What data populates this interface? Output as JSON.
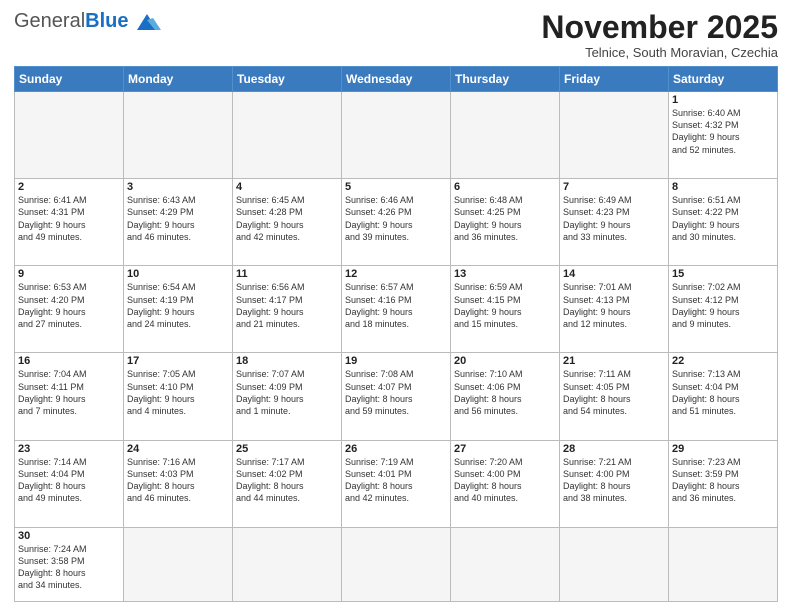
{
  "header": {
    "logo": {
      "general": "General",
      "blue": "Blue"
    },
    "title": "November 2025",
    "subtitle": "Telnice, South Moravian, Czechia"
  },
  "weekdays": [
    "Sunday",
    "Monday",
    "Tuesday",
    "Wednesday",
    "Thursday",
    "Friday",
    "Saturday"
  ],
  "weeks": [
    [
      {
        "day": "",
        "info": ""
      },
      {
        "day": "",
        "info": ""
      },
      {
        "day": "",
        "info": ""
      },
      {
        "day": "",
        "info": ""
      },
      {
        "day": "",
        "info": ""
      },
      {
        "day": "",
        "info": ""
      },
      {
        "day": "1",
        "info": "Sunrise: 6:40 AM\nSunset: 4:32 PM\nDaylight: 9 hours\nand 52 minutes."
      }
    ],
    [
      {
        "day": "2",
        "info": "Sunrise: 6:41 AM\nSunset: 4:31 PM\nDaylight: 9 hours\nand 49 minutes."
      },
      {
        "day": "3",
        "info": "Sunrise: 6:43 AM\nSunset: 4:29 PM\nDaylight: 9 hours\nand 46 minutes."
      },
      {
        "day": "4",
        "info": "Sunrise: 6:45 AM\nSunset: 4:28 PM\nDaylight: 9 hours\nand 42 minutes."
      },
      {
        "day": "5",
        "info": "Sunrise: 6:46 AM\nSunset: 4:26 PM\nDaylight: 9 hours\nand 39 minutes."
      },
      {
        "day": "6",
        "info": "Sunrise: 6:48 AM\nSunset: 4:25 PM\nDaylight: 9 hours\nand 36 minutes."
      },
      {
        "day": "7",
        "info": "Sunrise: 6:49 AM\nSunset: 4:23 PM\nDaylight: 9 hours\nand 33 minutes."
      },
      {
        "day": "8",
        "info": "Sunrise: 6:51 AM\nSunset: 4:22 PM\nDaylight: 9 hours\nand 30 minutes."
      }
    ],
    [
      {
        "day": "9",
        "info": "Sunrise: 6:53 AM\nSunset: 4:20 PM\nDaylight: 9 hours\nand 27 minutes."
      },
      {
        "day": "10",
        "info": "Sunrise: 6:54 AM\nSunset: 4:19 PM\nDaylight: 9 hours\nand 24 minutes."
      },
      {
        "day": "11",
        "info": "Sunrise: 6:56 AM\nSunset: 4:17 PM\nDaylight: 9 hours\nand 21 minutes."
      },
      {
        "day": "12",
        "info": "Sunrise: 6:57 AM\nSunset: 4:16 PM\nDaylight: 9 hours\nand 18 minutes."
      },
      {
        "day": "13",
        "info": "Sunrise: 6:59 AM\nSunset: 4:15 PM\nDaylight: 9 hours\nand 15 minutes."
      },
      {
        "day": "14",
        "info": "Sunrise: 7:01 AM\nSunset: 4:13 PM\nDaylight: 9 hours\nand 12 minutes."
      },
      {
        "day": "15",
        "info": "Sunrise: 7:02 AM\nSunset: 4:12 PM\nDaylight: 9 hours\nand 9 minutes."
      }
    ],
    [
      {
        "day": "16",
        "info": "Sunrise: 7:04 AM\nSunset: 4:11 PM\nDaylight: 9 hours\nand 7 minutes."
      },
      {
        "day": "17",
        "info": "Sunrise: 7:05 AM\nSunset: 4:10 PM\nDaylight: 9 hours\nand 4 minutes."
      },
      {
        "day": "18",
        "info": "Sunrise: 7:07 AM\nSunset: 4:09 PM\nDaylight: 9 hours\nand 1 minute."
      },
      {
        "day": "19",
        "info": "Sunrise: 7:08 AM\nSunset: 4:07 PM\nDaylight: 8 hours\nand 59 minutes."
      },
      {
        "day": "20",
        "info": "Sunrise: 7:10 AM\nSunset: 4:06 PM\nDaylight: 8 hours\nand 56 minutes."
      },
      {
        "day": "21",
        "info": "Sunrise: 7:11 AM\nSunset: 4:05 PM\nDaylight: 8 hours\nand 54 minutes."
      },
      {
        "day": "22",
        "info": "Sunrise: 7:13 AM\nSunset: 4:04 PM\nDaylight: 8 hours\nand 51 minutes."
      }
    ],
    [
      {
        "day": "23",
        "info": "Sunrise: 7:14 AM\nSunset: 4:04 PM\nDaylight: 8 hours\nand 49 minutes."
      },
      {
        "day": "24",
        "info": "Sunrise: 7:16 AM\nSunset: 4:03 PM\nDaylight: 8 hours\nand 46 minutes."
      },
      {
        "day": "25",
        "info": "Sunrise: 7:17 AM\nSunset: 4:02 PM\nDaylight: 8 hours\nand 44 minutes."
      },
      {
        "day": "26",
        "info": "Sunrise: 7:19 AM\nSunset: 4:01 PM\nDaylight: 8 hours\nand 42 minutes."
      },
      {
        "day": "27",
        "info": "Sunrise: 7:20 AM\nSunset: 4:00 PM\nDaylight: 8 hours\nand 40 minutes."
      },
      {
        "day": "28",
        "info": "Sunrise: 7:21 AM\nSunset: 4:00 PM\nDaylight: 8 hours\nand 38 minutes."
      },
      {
        "day": "29",
        "info": "Sunrise: 7:23 AM\nSunset: 3:59 PM\nDaylight: 8 hours\nand 36 minutes."
      }
    ],
    [
      {
        "day": "30",
        "info": "Sunrise: 7:24 AM\nSunset: 3:58 PM\nDaylight: 8 hours\nand 34 minutes."
      },
      {
        "day": "",
        "info": ""
      },
      {
        "day": "",
        "info": ""
      },
      {
        "day": "",
        "info": ""
      },
      {
        "day": "",
        "info": ""
      },
      {
        "day": "",
        "info": ""
      },
      {
        "day": "",
        "info": ""
      }
    ]
  ]
}
